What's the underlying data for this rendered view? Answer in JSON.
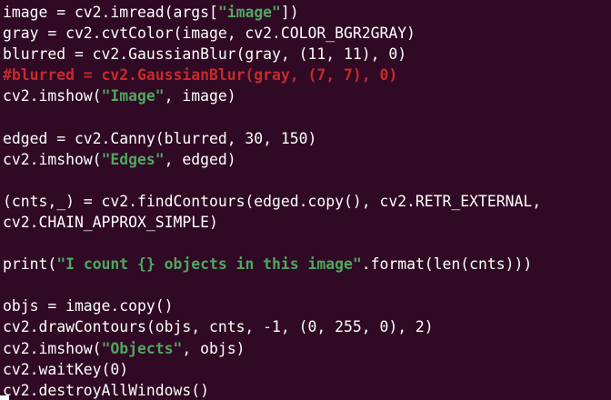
{
  "editor": {
    "colors": {
      "background": "#300a24",
      "text": "#ffffff",
      "string": "#4fa561",
      "comment": "#c52a2d"
    },
    "lines": [
      [
        {
          "t": "image = cv2.imread(args[",
          "k": "code"
        },
        {
          "t": "\"image\"",
          "k": "str"
        },
        {
          "t": "])",
          "k": "code"
        }
      ],
      [
        {
          "t": "gray = cv2.cvtColor(image, cv2.COLOR_BGR2GRAY)",
          "k": "code"
        }
      ],
      [
        {
          "t": "blurred = cv2.GaussianBlur(gray, (11, 11), 0)",
          "k": "code"
        }
      ],
      [
        {
          "t": "#blurred = cv2.GaussianBlur(gray, (7, 7), 0)",
          "k": "comment"
        }
      ],
      [
        {
          "t": "cv2.imshow(",
          "k": "code"
        },
        {
          "t": "\"Image\"",
          "k": "str"
        },
        {
          "t": ", image)",
          "k": "code"
        }
      ],
      [],
      [
        {
          "t": "edged = cv2.Canny(blurred, 30, 150)",
          "k": "code"
        }
      ],
      [
        {
          "t": "cv2.imshow(",
          "k": "code"
        },
        {
          "t": "\"Edges\"",
          "k": "str"
        },
        {
          "t": ", edged)",
          "k": "code"
        }
      ],
      [],
      [
        {
          "t": "(cnts,_) = cv2.findContours(edged.copy(), cv2.RETR_EXTERNAL,",
          "k": "code"
        }
      ],
      [
        {
          "t": "cv2.CHAIN_APPROX_SIMPLE)",
          "k": "code"
        }
      ],
      [],
      [
        {
          "t": "print(",
          "k": "code"
        },
        {
          "t": "\"I count {} objects in this image\"",
          "k": "str"
        },
        {
          "t": ".format(len(cnts)))",
          "k": "code"
        }
      ],
      [],
      [
        {
          "t": "objs = image.copy()",
          "k": "code"
        }
      ],
      [
        {
          "t": "cv2.drawContours(objs, cnts, -1, (0, 255, 0), 2)",
          "k": "code"
        }
      ],
      [
        {
          "t": "cv2.imshow(",
          "k": "code"
        },
        {
          "t": "\"Objects\"",
          "k": "str"
        },
        {
          "t": ", objs)",
          "k": "code"
        }
      ],
      [
        {
          "t": "cv2.waitKey(0)",
          "k": "code"
        }
      ],
      [
        {
          "t": "cv2.destroyAllWindows()",
          "k": "code"
        }
      ]
    ]
  }
}
